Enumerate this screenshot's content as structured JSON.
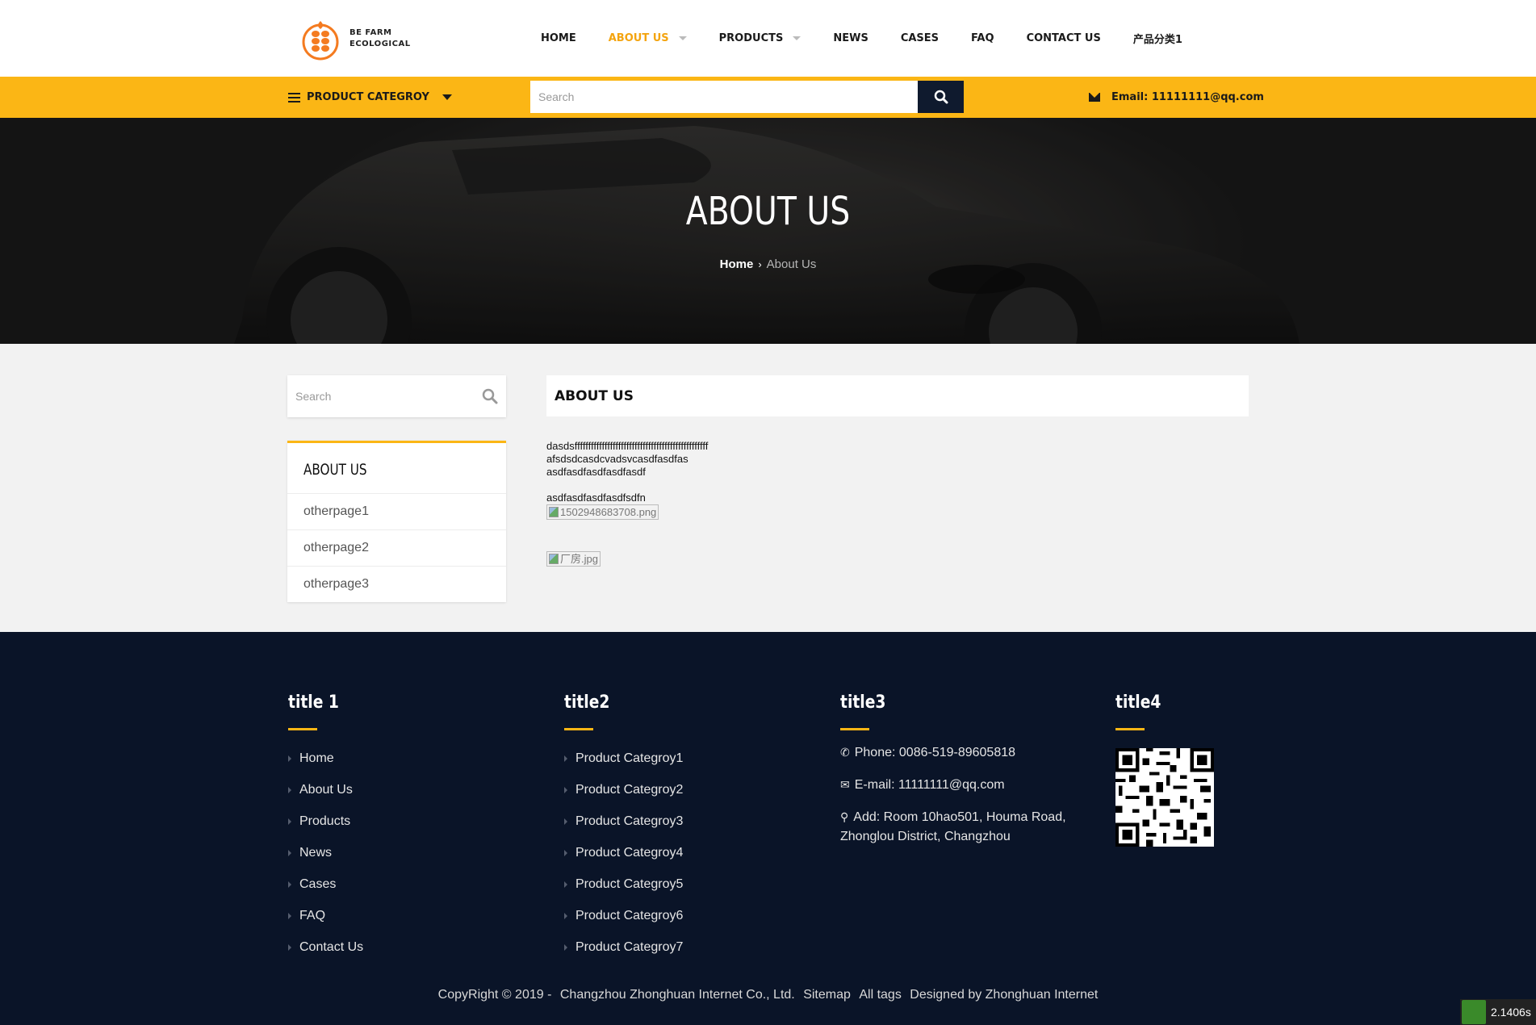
{
  "brand": {
    "line1": "BE FARM",
    "line2": "ECOLOGICAL",
    "accent": "#f47b20"
  },
  "nav": {
    "items": [
      {
        "label": "HOME",
        "active": false,
        "caret": false
      },
      {
        "label": "ABOUT US",
        "active": true,
        "caret": true
      },
      {
        "label": "PRODUCTS",
        "active": false,
        "caret": true
      },
      {
        "label": "NEWS",
        "active": false,
        "caret": false
      },
      {
        "label": "CASES",
        "active": false,
        "caret": false
      },
      {
        "label": "FAQ",
        "active": false,
        "caret": false
      },
      {
        "label": "CONTACT US",
        "active": false,
        "caret": false
      },
      {
        "label": "产品分类1",
        "active": false,
        "caret": false
      }
    ]
  },
  "topbar": {
    "category_label": "PRODUCT CATEGROY",
    "search_placeholder": "Search",
    "email": "Email: 11111111@qq.com",
    "color": "#fbb615"
  },
  "banner": {
    "title": "ABOUT US",
    "crumb_home": "Home",
    "crumb_current": "About Us"
  },
  "sidebar": {
    "search_placeholder": "Search",
    "heading": "ABOUT US",
    "items": [
      {
        "label": "otherpage1"
      },
      {
        "label": "otherpage2"
      },
      {
        "label": "otherpage3"
      }
    ]
  },
  "main": {
    "heading": "ABOUT US",
    "lines": [
      "dasdsfffffffffffffffffffffffffffffffffffffffffffffffff",
      "afsdsdcasdcvadsvcasdfasdfas",
      "asdfasdfasdfasdfasdf"
    ],
    "line4": "asdfasdfasdfasdfsdfn",
    "img1_alt": "1502948683708.png",
    "img2_alt": "厂房.jpg"
  },
  "footer": {
    "col1": {
      "title": "title 1",
      "items": [
        "Home",
        "About Us",
        "Products",
        "News",
        "Cases",
        "FAQ",
        "Contact Us"
      ]
    },
    "col2": {
      "title": "title2",
      "items": [
        "Product Categroy1",
        "Product Categroy2",
        "Product Categroy3",
        "Product Categroy4",
        "Product Categroy5",
        "Product Categroy6",
        "Product Categroy7"
      ]
    },
    "col3": {
      "title": "title3",
      "phone": "Phone: 0086-519-89605818",
      "email": "E-mail: 11111111@qq.com",
      "address": "Add: Room 10hao501, Houma Road, Zhonglou District, Changzhou"
    },
    "col4": {
      "title": "title4"
    },
    "copyright": "CopyRight © 2019 -",
    "company": "Changzhou Zhonghuan Internet Co., Ltd.",
    "sitemap": "Sitemap",
    "alltags": "All tags",
    "designed": "Designed by Zhonghuan Internet",
    "background": "#0a1428"
  },
  "perf": {
    "time": "2.1406s"
  }
}
